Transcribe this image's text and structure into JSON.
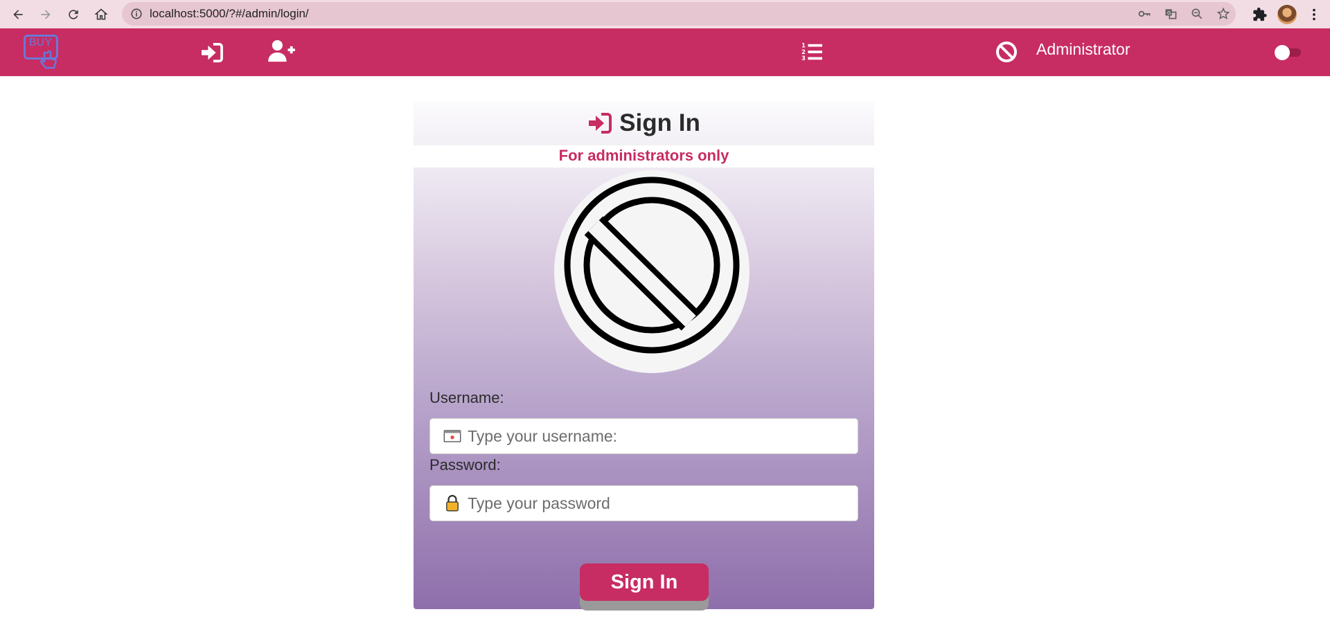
{
  "browser": {
    "url": "localhost:5000/?#/admin/login/"
  },
  "navbar": {
    "logo_text": "BUY",
    "admin_label": "Administrator"
  },
  "card": {
    "title": "Sign In",
    "subtitle": "For administrators only",
    "username_label": "Username:",
    "username_placeholder": "Type your username:",
    "password_label": "Password:",
    "password_placeholder": "Type your password",
    "submit_label": "Sign In"
  },
  "colors": {
    "brand": "#c72c62",
    "chrome": "#f3dde4",
    "logo": "#6b77d8"
  },
  "icons": [
    "back-icon",
    "forward-icon",
    "reload-icon",
    "home-icon",
    "info-icon",
    "key-icon",
    "translate-icon",
    "zoom-out-icon",
    "star-icon",
    "extensions-icon",
    "menu-icon",
    "sign-in-icon",
    "add-user-icon",
    "ordered-list-icon",
    "ban-icon",
    "id-card-icon",
    "lock-icon"
  ]
}
